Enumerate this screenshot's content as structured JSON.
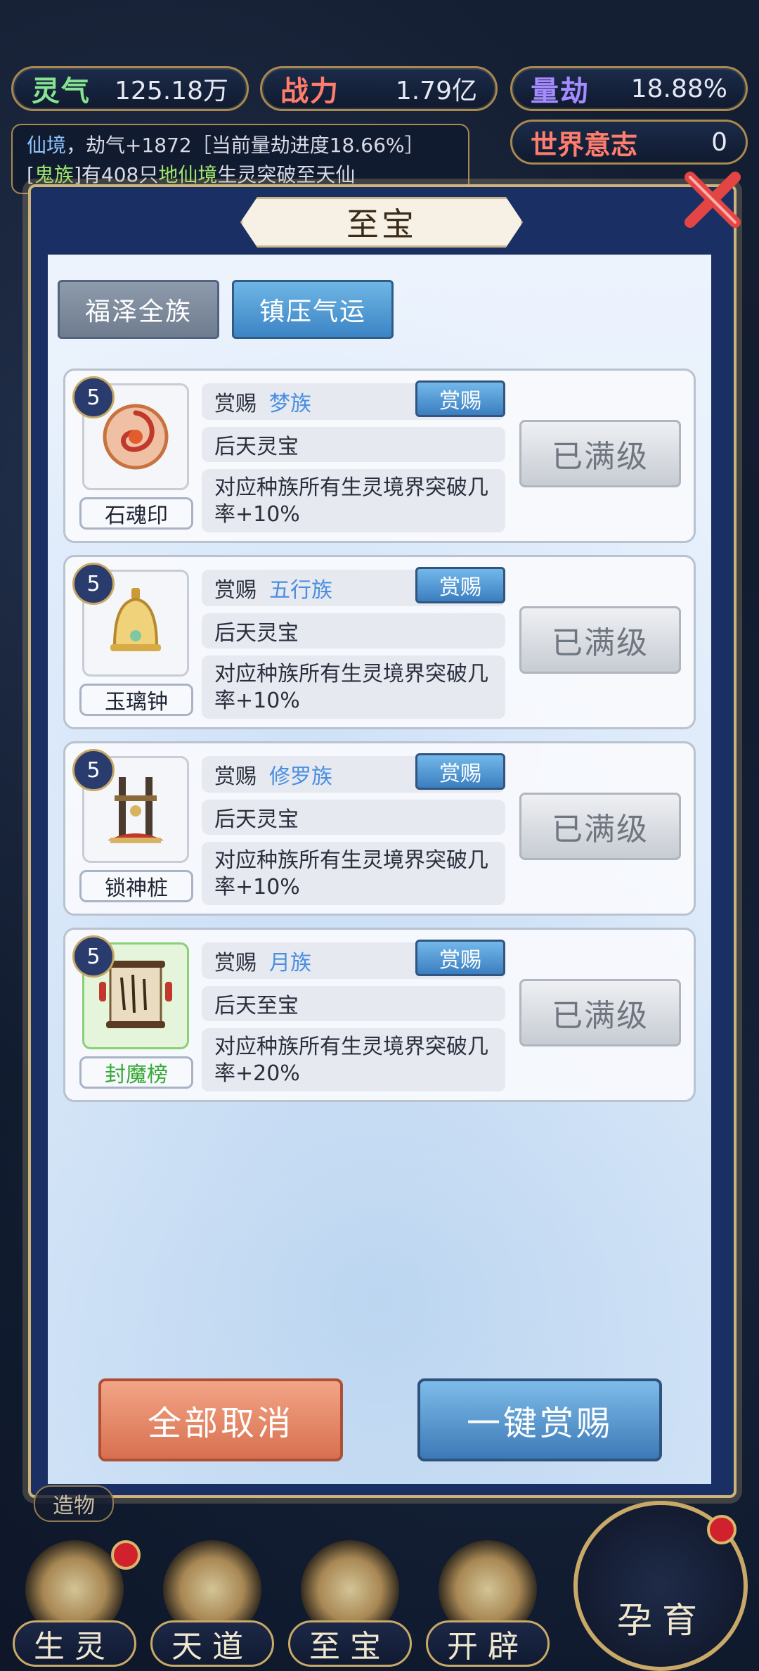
{
  "stats": {
    "lingqi": {
      "label": "灵气",
      "value": "125.18万"
    },
    "zhanli": {
      "label": "战力",
      "value": "1.79亿"
    },
    "liangjie": {
      "label": "量劫",
      "value": "18.88%"
    },
    "world": {
      "label": "世界意志",
      "value": "0"
    }
  },
  "log": {
    "line1_realm": "仙境",
    "line1_rest": "，劫气+1872［当前量劫进度18.66%］",
    "line2_open": "[",
    "line2_tribe": "鬼族",
    "line2_mid": "]有408只",
    "line2_realm": "地仙境",
    "line2_rest": "生灵突破至天仙"
  },
  "modal": {
    "title": "至宝",
    "tabs": [
      "福泽全族",
      "镇压气运"
    ]
  },
  "items": [
    {
      "level": "5",
      "name": "石魂印",
      "reward_label": "赏赐",
      "tribe": "梦族",
      "button": "赏赐",
      "category": "后天灵宝",
      "desc": "对应种族所有生灵境界突破几率+10%",
      "status": "已满级"
    },
    {
      "level": "5",
      "name": "玉璃钟",
      "reward_label": "赏赐",
      "tribe": "五行族",
      "button": "赏赐",
      "category": "后天灵宝",
      "desc": "对应种族所有生灵境界突破几率+10%",
      "status": "已满级"
    },
    {
      "level": "5",
      "name": "锁神桩",
      "reward_label": "赏赐",
      "tribe": "修罗族",
      "button": "赏赐",
      "category": "后天灵宝",
      "desc": "对应种族所有生灵境界突破几率+10%",
      "status": "已满级"
    },
    {
      "level": "5",
      "name": "封魔榜",
      "reward_label": "赏赐",
      "tribe": "月族",
      "button": "赏赐",
      "category": "后天至宝",
      "desc": "对应种族所有生灵境界突破几率+20%",
      "status": "已满级"
    }
  ],
  "actions": {
    "cancel_all": "全部取消",
    "reward_all": "一键赏赐"
  },
  "nav": {
    "small_label": "造物",
    "items": [
      "生灵",
      "天道",
      "至宝",
      "开辟",
      "孕育"
    ]
  },
  "colors": {
    "accent_gold": "#c9a968",
    "tribe_blue": "#4a8ee0",
    "reward_blue": "#3b7ec0",
    "cancel_orange": "#d87050"
  }
}
